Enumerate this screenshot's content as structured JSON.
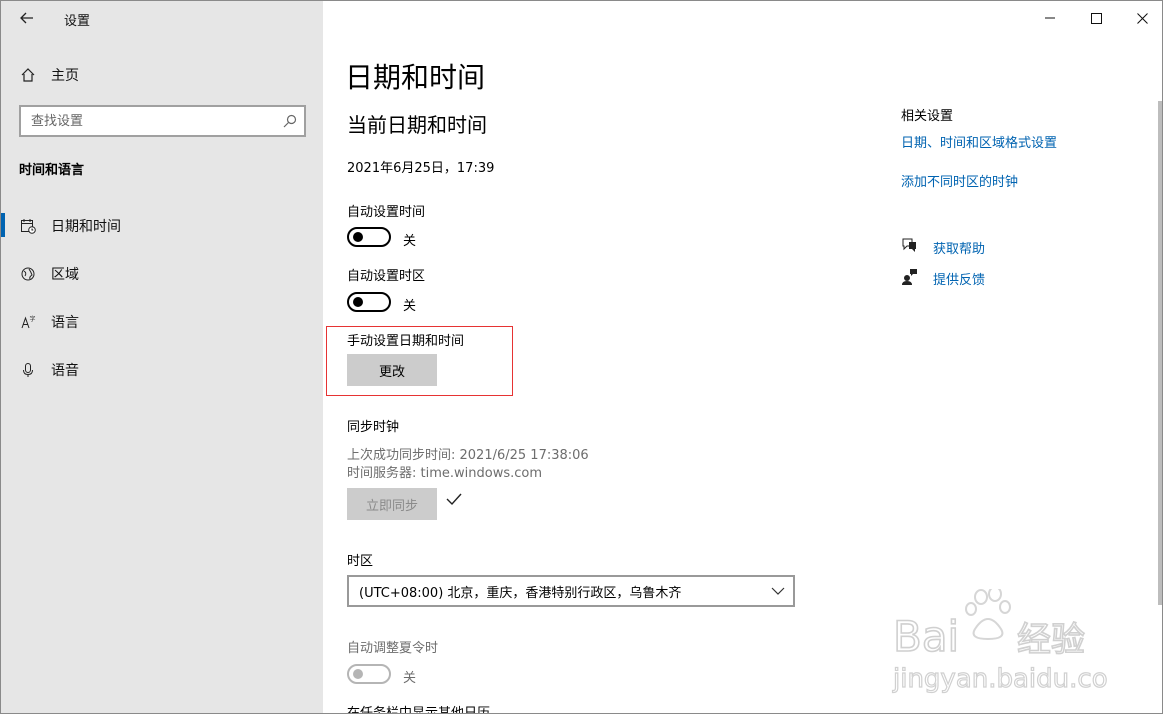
{
  "app": {
    "title": "设置"
  },
  "sidebar": {
    "home_label": "主页",
    "search_placeholder": "查找设置",
    "section_title": "时间和语言",
    "items": [
      {
        "label": "日期和时间",
        "icon": "calendar-clock-icon",
        "active": true
      },
      {
        "label": "区域",
        "icon": "globe-icon",
        "active": false
      },
      {
        "label": "语言",
        "icon": "language-icon",
        "active": false
      },
      {
        "label": "语音",
        "icon": "microphone-icon",
        "active": false
      }
    ]
  },
  "main": {
    "page_title": "日期和时间",
    "current_heading": "当前日期和时间",
    "current_datetime": "2021年6月25日，17:39",
    "auto_time": {
      "label": "自动设置时间",
      "state": "关"
    },
    "auto_timezone": {
      "label": "自动设置时区",
      "state": "关"
    },
    "manual": {
      "label": "手动设置日期和时间",
      "button": "更改"
    },
    "sync": {
      "label": "同步时钟",
      "last_sync": "上次成功同步时间: 2021/6/25 17:38:06",
      "server": "时间服务器: time.windows.com",
      "button": "立即同步"
    },
    "timezone": {
      "label": "时区",
      "value": "(UTC+08:00) 北京，重庆，香港特别行政区，乌鲁木齐"
    },
    "dst": {
      "label": "自动调整夏令时",
      "state": "关"
    },
    "calendar_label": "在任务栏中显示其他日历"
  },
  "related": {
    "title": "相关设置",
    "link1": "日期、时间和区域格式设置",
    "link2": "添加不同时区的时钟",
    "help": "获取帮助",
    "feedback": "提供反馈"
  },
  "watermark": {
    "brand": "Baidu经验",
    "url": "jingyan.baidu.com"
  },
  "colors": {
    "accent": "#0063b1",
    "sidebar_bg": "#e6e6e6",
    "highlight_box": "#e63333"
  }
}
